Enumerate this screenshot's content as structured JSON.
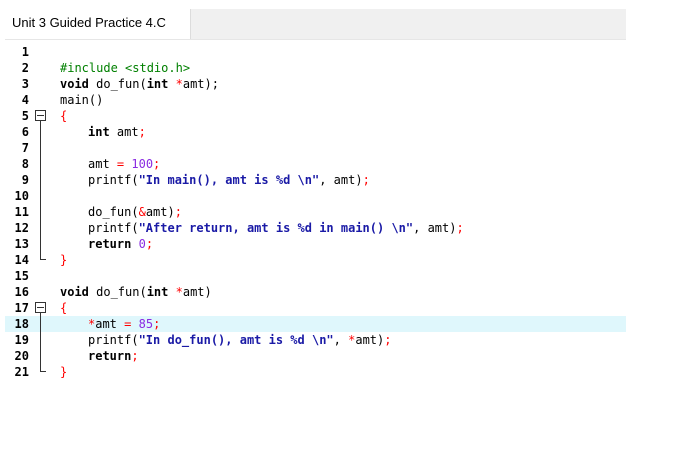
{
  "tab": {
    "title": "Unit 3 Guided Practice 4.C"
  },
  "lines": [
    {
      "n": "1"
    },
    {
      "n": "2",
      "preprocessor": "#include <stdio.h>"
    },
    {
      "n": "3",
      "kw": "void",
      "name": " do_fun(",
      "kw2": "int",
      "op": " *",
      "rest": "amt);"
    },
    {
      "n": "4",
      "text": "main()"
    },
    {
      "n": "5",
      "op": "{"
    },
    {
      "n": "6",
      "kw": "int",
      "rest": " amt",
      "semi": ";"
    },
    {
      "n": "7"
    },
    {
      "n": "8",
      "lhs": "amt ",
      "eq": "=",
      "num": " 100",
      "semi": ";"
    },
    {
      "n": "9",
      "fn": "printf(",
      "str": "\"In main(), amt is %d \\n\"",
      "rest": ", amt)",
      "semi": ";"
    },
    {
      "n": "10"
    },
    {
      "n": "11",
      "fn": "do_fun(",
      "op": "&",
      "rest": "amt)",
      "semi": ";"
    },
    {
      "n": "12",
      "fn": "printf(",
      "str": "\"After return, amt is %d in main() \\n\"",
      "rest": ", amt)",
      "semi": ";"
    },
    {
      "n": "13",
      "kw": "return",
      "num": " 0",
      "semi": ";"
    },
    {
      "n": "14",
      "op": "}"
    },
    {
      "n": "15"
    },
    {
      "n": "16",
      "kw": "void",
      "name": " do_fun(",
      "kw2": "int",
      "op": " *",
      "rest": "amt)"
    },
    {
      "n": "17",
      "op": "{"
    },
    {
      "n": "18",
      "op": "*",
      "lhs": "amt ",
      "eq": "=",
      "num": " 85",
      "semi": ";"
    },
    {
      "n": "19",
      "fn": "printf(",
      "str": "\"In do_fun(), amt is %d \\n\"",
      "rest": ", ",
      "op2": "*",
      "rest2": "amt)",
      "semi": ";"
    },
    {
      "n": "20",
      "kw": "return",
      "semi": ";"
    },
    {
      "n": "21",
      "op": "}"
    }
  ],
  "highlighted_line": "18",
  "colors": {
    "highlight": "#dff7fc",
    "string": "#1a1aa6",
    "preprocessor": "#008000",
    "number": "#8a2be2",
    "operator": "#ff0000"
  }
}
